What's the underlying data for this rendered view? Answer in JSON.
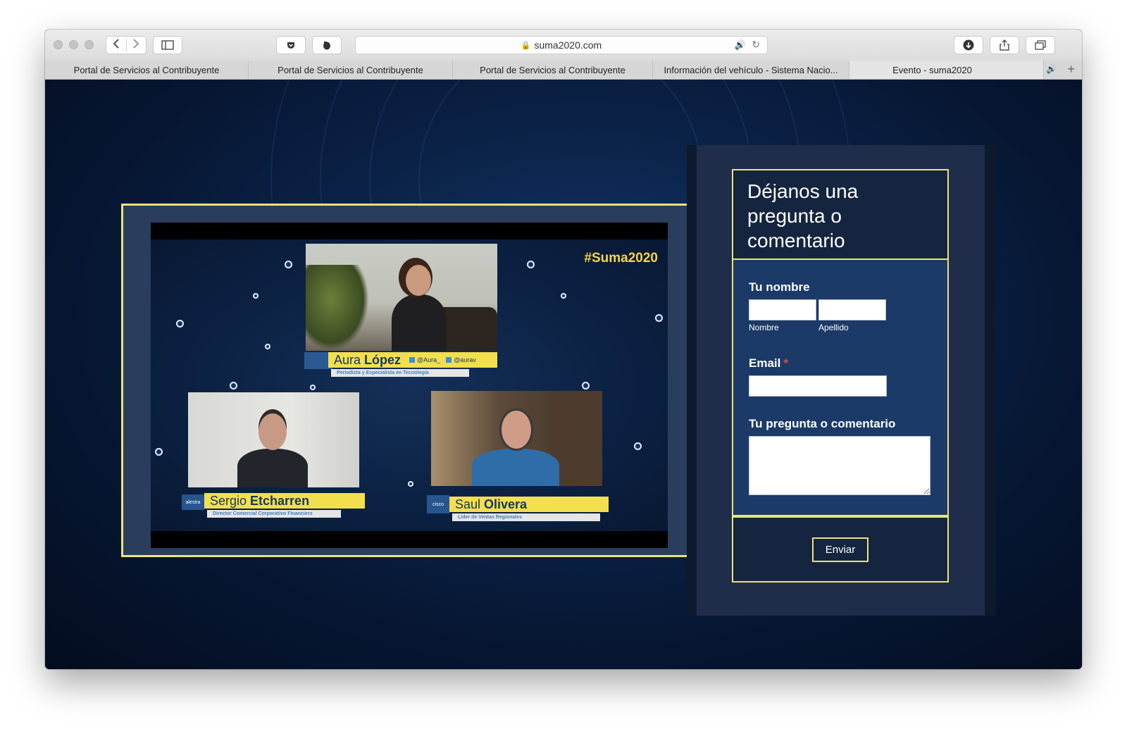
{
  "browser": {
    "url": "suma2020.com",
    "tabs": [
      {
        "title": "Portal de Servicios al Contribuyente",
        "active": false
      },
      {
        "title": "Portal de Servicios al Contribuyente",
        "active": false
      },
      {
        "title": "Portal de Servicios al Contribuyente",
        "active": false
      },
      {
        "title": "Información del vehículo - Sistema Nacio...",
        "active": false
      },
      {
        "title": "Evento - suma2020",
        "active": true
      }
    ],
    "icons": [
      "back-icon",
      "forward-icon",
      "sidebar-icon",
      "pocket-icon",
      "evernote-icon",
      "lock-icon",
      "audio-icon",
      "reload-icon",
      "download-icon",
      "share-icon",
      "tabs-overview-icon",
      "new-tab-icon"
    ]
  },
  "video": {
    "hashtag": "#Suma2020",
    "speakers": [
      {
        "first": "Aura",
        "last": "López",
        "role": "Periodista y Especialista en Tecnología",
        "handles": [
          "@Aura_",
          "@aurav"
        ]
      },
      {
        "first": "Sergio",
        "last": "Etcharren",
        "role": "Director Comercial Corporativo Financiero",
        "logo": "alestra"
      },
      {
        "first": "Saul",
        "last": "Olivera",
        "role": "Líder de Ventas Regionales",
        "logo": "cisco"
      }
    ]
  },
  "form": {
    "title": "Déjanos una pregunta o comentario",
    "name_label": "Tu nombre",
    "first_name_sub": "Nombre",
    "last_name_sub": "Apellido",
    "email_label": "Email",
    "required_mark": "*",
    "comment_label": "Tu pregunta o comentario",
    "first_name_value": "",
    "last_name_value": "",
    "email_value": "",
    "comment_value": "",
    "submit_label": "Enviar"
  },
  "colors": {
    "accent": "#ebe37b",
    "page_bg": "#0b2247",
    "form_body": "#1c3a68",
    "required": "#e24a3a"
  }
}
